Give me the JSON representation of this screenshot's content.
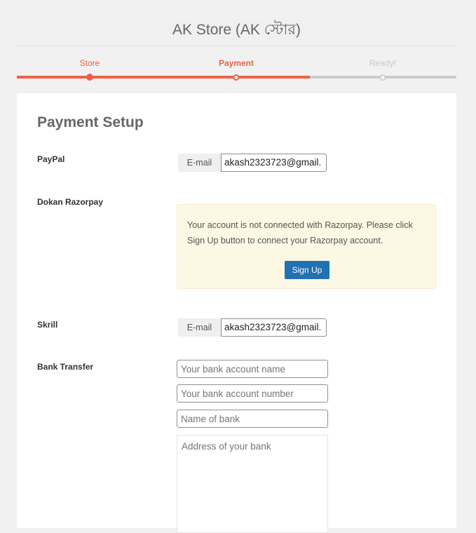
{
  "header": {
    "title": "AK Store (AK স্টোর)"
  },
  "steps": [
    {
      "label": "Store",
      "state": "done"
    },
    {
      "label": "Payment",
      "state": "active"
    },
    {
      "label": "Ready!",
      "state": "todo"
    }
  ],
  "colors": {
    "accent": "#ee6147",
    "inactive": "#cccccc",
    "button": "#2271b1",
    "notice_bg": "#fcf8e3"
  },
  "main": {
    "title": "Payment Setup",
    "paypal": {
      "label": "PayPal",
      "addon": "E-mail",
      "value": "akash2323723@gmail."
    },
    "razorpay": {
      "label": "Dokan Razorpay",
      "notice": "Your account is not connected with Razorpay. Please click Sign Up button to connect your Razorpay account.",
      "button": "Sign Up"
    },
    "skrill": {
      "label": "Skrill",
      "addon": "E-mail",
      "value": "akash2323723@gmail."
    },
    "bank": {
      "label": "Bank Transfer",
      "account_name_placeholder": "Your bank account name",
      "account_number_placeholder": "Your bank account number",
      "bank_name_placeholder": "Name of bank",
      "address_placeholder": "Address of your bank"
    }
  }
}
